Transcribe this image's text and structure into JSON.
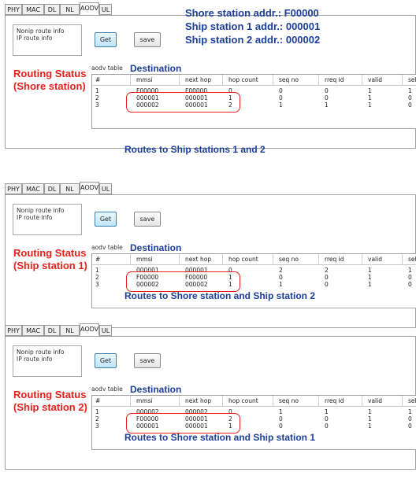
{
  "tabs": [
    "PHY",
    "MAC",
    "DL",
    "NL",
    "AODV",
    "UL"
  ],
  "options": [
    "Nonip route info",
    "IP route info"
  ],
  "buttons": {
    "get": "Get",
    "save": "save"
  },
  "table_label": "aodv table",
  "columns": [
    "#",
    "mmsi",
    "next hop",
    "hop count",
    "seq no",
    "rreq id",
    "valid",
    "self"
  ],
  "panels": [
    {
      "status_title": "Routing Status",
      "status_sub": "(Shore station)",
      "rows": [
        [
          "1",
          "F00000",
          "F00000",
          "0",
          "0",
          "0",
          "1",
          "1"
        ],
        [
          "2",
          "000001",
          "000001",
          "1",
          "0",
          "0",
          "1",
          "0"
        ],
        [
          "3",
          "000002",
          "000001",
          "2",
          "1",
          "1",
          "1",
          "0"
        ]
      ],
      "destination": "Destination",
      "caption": "Routes to Ship stations 1 and 2"
    },
    {
      "status_title": "Routing Status",
      "status_sub": "(Ship station 1)",
      "rows": [
        [
          "1",
          "000001",
          "000001",
          "0",
          "2",
          "2",
          "1",
          "1"
        ],
        [
          "2",
          "F00000",
          "F00000",
          "1",
          "0",
          "0",
          "1",
          "0"
        ],
        [
          "3",
          "000002",
          "000002",
          "1",
          "1",
          "0",
          "1",
          "0"
        ]
      ],
      "destination": "Destination",
      "caption": "Routes to Shore station and Ship station 2"
    },
    {
      "status_title": "Routing Status",
      "status_sub": "(Ship station 2)",
      "rows": [
        [
          "1",
          "000002",
          "000002",
          "0",
          "1",
          "1",
          "1",
          "1"
        ],
        [
          "2",
          "F00000",
          "000001",
          "2",
          "0",
          "0",
          "1",
          "0"
        ],
        [
          "3",
          "000001",
          "000001",
          "1",
          "0",
          "0",
          "1",
          "0"
        ]
      ],
      "destination": "Destination",
      "caption": "Routes to Shore station and Ship station 1"
    }
  ],
  "addresses": [
    "Shore station addr.: F00000",
    "Ship station 1 addr.: 000001",
    "Ship station 2 addr.: 000002"
  ],
  "colors": {
    "annotation_red": "#e8211c",
    "annotation_blue": "#1d3f9a",
    "active_button": "#bee6fd"
  }
}
